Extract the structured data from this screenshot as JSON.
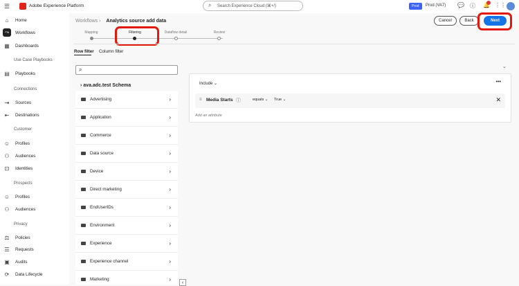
{
  "topbar": {
    "app_name": "Adobe Experience Platform",
    "search_placeholder": "Search Experience Cloud (⌘+/)",
    "env_badge": "Prod",
    "env_name": "Prod (VA7)",
    "notification_count": ""
  },
  "sidebar": {
    "items": [
      {
        "label": "Home",
        "icon": "⌂",
        "type": "item"
      },
      {
        "label": "Workflows",
        "icon": "⤳",
        "type": "item",
        "active": true
      },
      {
        "label": "Dashboards",
        "icon": "▦",
        "type": "item"
      },
      {
        "label": "Use Case Playbooks",
        "type": "section"
      },
      {
        "label": "Playbooks",
        "icon": "▤",
        "type": "item"
      },
      {
        "label": "Connections",
        "type": "section"
      },
      {
        "label": "Sources",
        "icon": "⇥",
        "type": "item"
      },
      {
        "label": "Destinations",
        "icon": "⇤",
        "type": "item"
      },
      {
        "label": "Customer",
        "type": "section"
      },
      {
        "label": "Profiles",
        "icon": "☺",
        "type": "item"
      },
      {
        "label": "Audiences",
        "icon": "⚇",
        "type": "item"
      },
      {
        "label": "Identities",
        "icon": "⊡",
        "type": "item"
      },
      {
        "label": "Prospects",
        "type": "section"
      },
      {
        "label": "Profiles",
        "icon": "☺",
        "type": "item"
      },
      {
        "label": "Audiences",
        "icon": "⚇",
        "type": "item"
      },
      {
        "label": "Privacy",
        "type": "section"
      },
      {
        "label": "Policies",
        "icon": "⚖",
        "type": "item"
      },
      {
        "label": "Requests",
        "icon": "☰",
        "type": "item"
      },
      {
        "label": "Audits",
        "icon": "▣",
        "type": "item"
      },
      {
        "label": "Data Lifecycle",
        "icon": "⟳",
        "type": "item"
      }
    ]
  },
  "header": {
    "breadcrumb_parent": "Workflows",
    "title": "Analytics source add data",
    "cancel": "Cancel",
    "back": "Back",
    "next": "Next"
  },
  "steps": [
    {
      "label": "Mapping",
      "state": "done"
    },
    {
      "label": "Filtering",
      "state": "current"
    },
    {
      "label": "Dataflow detail",
      "state": "todo"
    },
    {
      "label": "Review",
      "state": "todo"
    }
  ],
  "tabs": [
    "Row filter",
    "Column filter"
  ],
  "left": {
    "search_value": "",
    "schema": "ava.adc.test Schema",
    "categories": [
      "Advertising",
      "Application",
      "Commerce",
      "Data source",
      "Device",
      "Direct marketing",
      "EndUserIDs",
      "Environment",
      "Experience",
      "Experience channel",
      "Marketing"
    ]
  },
  "filter": {
    "mode": "Include",
    "condition": {
      "attribute": "Media Starts",
      "operator": "equals",
      "value": "True"
    },
    "add_label": "Add an attribute"
  },
  "colors": {
    "accent": "#1473e6",
    "highlight": "#e3170a"
  }
}
